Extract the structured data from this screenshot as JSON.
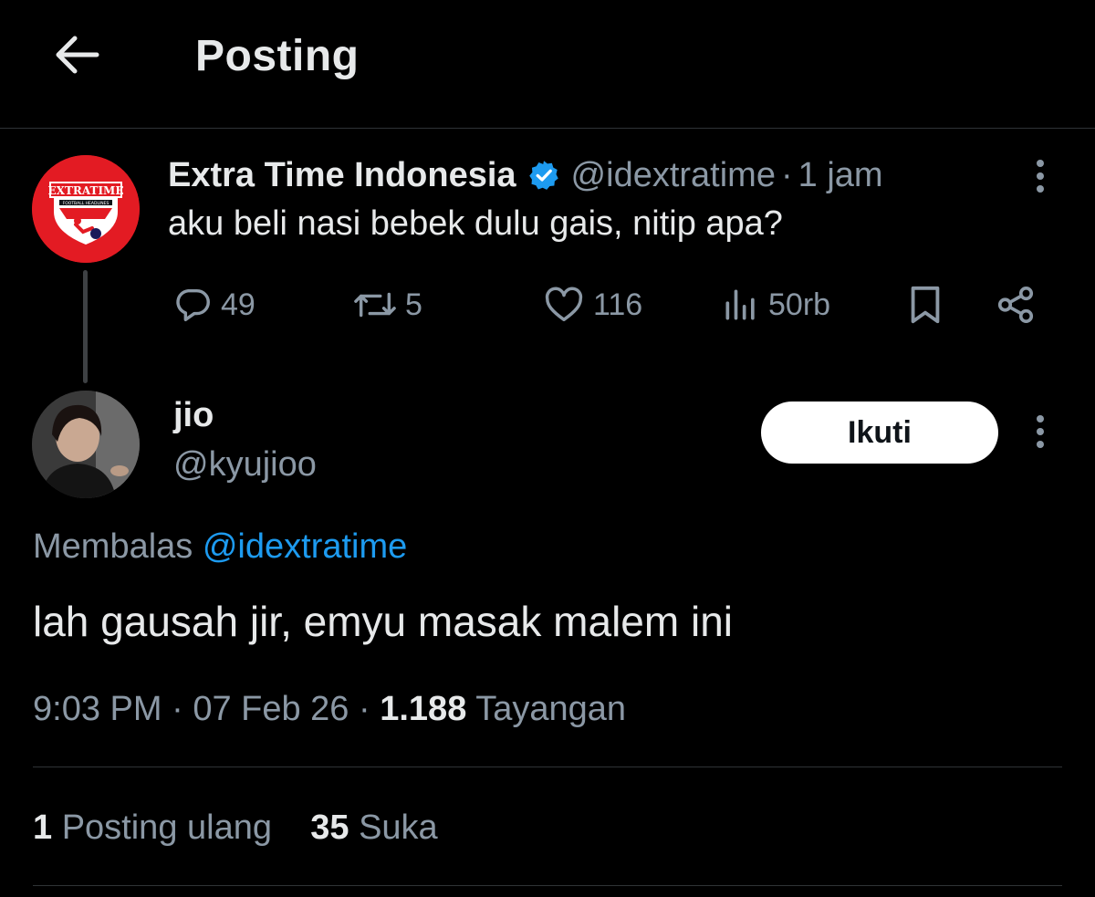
{
  "header": {
    "title": "Posting",
    "back_icon": "arrow-left-icon"
  },
  "parent_tweet": {
    "display_name": "Extra Time Indonesia",
    "verified": true,
    "verified_color": "#1d9bf0",
    "handle": "@idextratime",
    "separator": "·",
    "time": "1 jam",
    "text": "aku beli nasi bebek dulu gais, nitip apa?",
    "avatar": {
      "background": "#e31b23",
      "logo_text": "EXTRATIME",
      "logo_subtext": "FOOTBALL HEADLINES"
    },
    "actions": {
      "replies": "49",
      "reposts": "5",
      "likes": "116",
      "views": "50rb"
    }
  },
  "reply": {
    "author_name": "jio",
    "author_handle": "@kyujioo",
    "follow_label": "Ikuti",
    "replying_prefix": "Membalas",
    "replying_to": "@idextratime",
    "text": "lah gausah jir, emyu masak malem ini",
    "time": "9:03 PM",
    "date": "07 Feb 26",
    "separator": "·",
    "views_count": "1.188",
    "views_label": "Tayangan",
    "reposts_count": "1",
    "reposts_label": "Posting ulang",
    "likes_count": "35",
    "likes_label": "Suka"
  },
  "colors": {
    "background": "#000000",
    "text_primary": "#e7e9ea",
    "text_secondary": "#8b98a5",
    "link": "#1d9bf0",
    "divider": "#2f3336"
  }
}
